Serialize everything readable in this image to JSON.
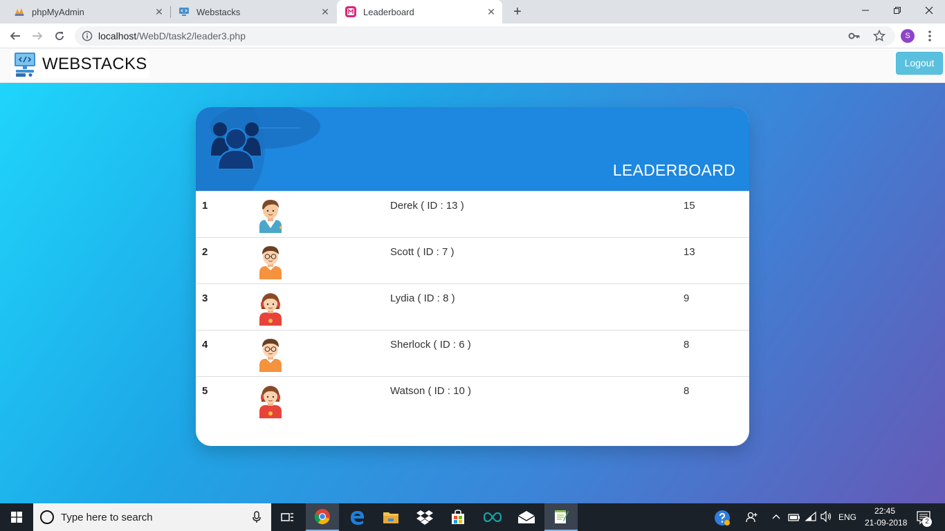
{
  "browser": {
    "tabs": [
      {
        "title": "phpMyAdmin",
        "active": false
      },
      {
        "title": "Webstacks",
        "active": false
      },
      {
        "title": "Leaderboard",
        "active": true
      }
    ],
    "url": {
      "host": "localhost",
      "path": "/WebD/task2/leader3.php"
    },
    "profile_initial": "S"
  },
  "page": {
    "brand": "WEBSTACKS",
    "logout_label": "Logout",
    "card_title": "LEADERBOARD",
    "rows": [
      {
        "rank": "1",
        "name": "Derek ( ID : 13 )",
        "score": "15",
        "avatar": "boy-green-icon"
      },
      {
        "rank": "2",
        "name": "Scott ( ID : 7 )",
        "score": "13",
        "avatar": "boy-glasses-icon"
      },
      {
        "rank": "3",
        "name": "Lydia ( ID : 8 )",
        "score": "9",
        "avatar": "girl-red-icon"
      },
      {
        "rank": "4",
        "name": "Sherlock ( ID : 6 )",
        "score": "8",
        "avatar": "boy-glasses-icon"
      },
      {
        "rank": "5",
        "name": "Watson ( ID : 10 )",
        "score": "8",
        "avatar": "girl-red-icon"
      }
    ]
  },
  "taskbar": {
    "search_placeholder": "Type here to search",
    "language": "ENG",
    "time": "22:45",
    "date": "21-09-2018",
    "notification_count": "2"
  },
  "colors": {
    "card_header": "#1e87df",
    "logout_button": "#5bc0de",
    "gradient_start": "#1fd8fc",
    "gradient_end": "#6559b6"
  }
}
